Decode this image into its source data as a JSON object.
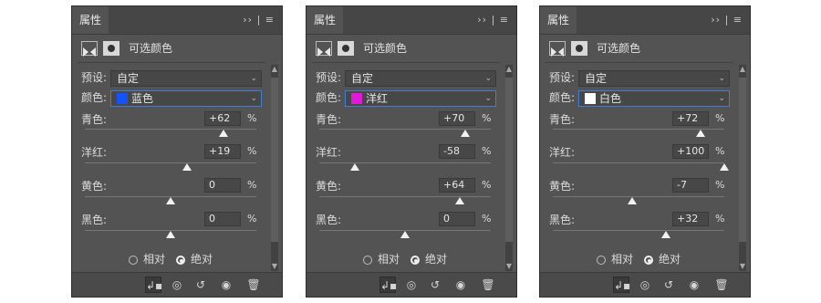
{
  "panels": [
    {
      "tab": "属性",
      "title_controls": "›› | ≡",
      "header_title": "可选颜色",
      "preset_label": "预设:",
      "preset_value": "自定",
      "color_label": "颜色:",
      "color_value": "蓝色",
      "swatch_color": "#1452ff",
      "cyan_label": "青色:",
      "cyan_value": "+62",
      "cyan_level": 62,
      "magenta_label": "洋红:",
      "magenta_value": "+19",
      "magenta_level": 19,
      "yellow_label": "黄色:",
      "yellow_value": "0",
      "yellow_level": 0,
      "black_label": "黑色:",
      "black_value": "0",
      "black_level": 0,
      "percent": "%",
      "relative_label": "相对",
      "absolute_label": "绝对",
      "method_selected": "absolute"
    },
    {
      "tab": "属性",
      "title_controls": "›› | ≡",
      "header_title": "可选颜色",
      "preset_label": "预设:",
      "preset_value": "自定",
      "color_label": "颜色:",
      "color_value": "洋红",
      "swatch_color": "#e01ad8",
      "cyan_label": "青色:",
      "cyan_value": "+70",
      "cyan_level": 70,
      "magenta_label": "洋红:",
      "magenta_value": "-58",
      "magenta_level": -58,
      "yellow_label": "黄色:",
      "yellow_value": "+64",
      "yellow_level": 64,
      "black_label": "黑色:",
      "black_value": "0",
      "black_level": 0,
      "percent": "%",
      "relative_label": "相对",
      "absolute_label": "绝对",
      "method_selected": "absolute"
    },
    {
      "tab": "属性",
      "title_controls": "›› | ≡",
      "header_title": "可选颜色",
      "preset_label": "预设:",
      "preset_value": "自定",
      "color_label": "颜色:",
      "color_value": "白色",
      "swatch_color": "#ffffff",
      "cyan_label": "青色:",
      "cyan_value": "+72",
      "cyan_level": 72,
      "magenta_label": "洋红:",
      "magenta_value": "+100",
      "magenta_level": 100,
      "yellow_label": "黄色:",
      "yellow_value": "-7",
      "yellow_level": -7,
      "black_label": "黑色:",
      "black_value": "+32",
      "black_level": 32,
      "percent": "%",
      "relative_label": "相对",
      "absolute_label": "绝对",
      "method_selected": "absolute"
    }
  ],
  "footer_icons": [
    "clip-to-layer-icon",
    "view-previous-icon",
    "reset-icon",
    "visibility-eye-icon",
    "delete-trash-icon"
  ]
}
